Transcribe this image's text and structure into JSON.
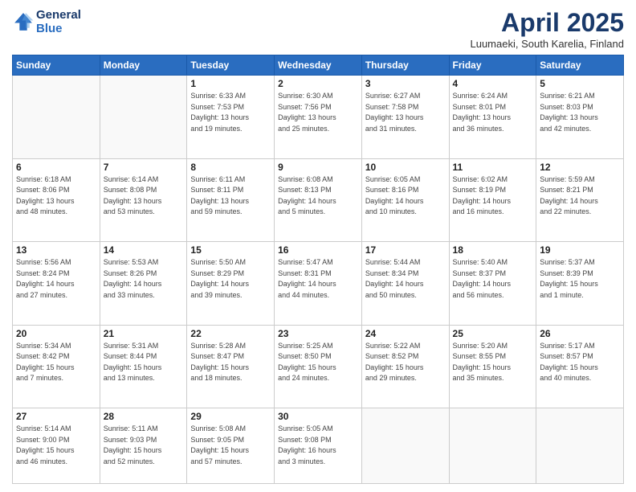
{
  "header": {
    "logo_line1": "General",
    "logo_line2": "Blue",
    "month": "April 2025",
    "location": "Luumaeki, South Karelia, Finland"
  },
  "weekdays": [
    "Sunday",
    "Monday",
    "Tuesday",
    "Wednesday",
    "Thursday",
    "Friday",
    "Saturday"
  ],
  "weeks": [
    [
      {
        "day": "",
        "info": ""
      },
      {
        "day": "",
        "info": ""
      },
      {
        "day": "1",
        "info": "Sunrise: 6:33 AM\nSunset: 7:53 PM\nDaylight: 13 hours\nand 19 minutes."
      },
      {
        "day": "2",
        "info": "Sunrise: 6:30 AM\nSunset: 7:56 PM\nDaylight: 13 hours\nand 25 minutes."
      },
      {
        "day": "3",
        "info": "Sunrise: 6:27 AM\nSunset: 7:58 PM\nDaylight: 13 hours\nand 31 minutes."
      },
      {
        "day": "4",
        "info": "Sunrise: 6:24 AM\nSunset: 8:01 PM\nDaylight: 13 hours\nand 36 minutes."
      },
      {
        "day": "5",
        "info": "Sunrise: 6:21 AM\nSunset: 8:03 PM\nDaylight: 13 hours\nand 42 minutes."
      }
    ],
    [
      {
        "day": "6",
        "info": "Sunrise: 6:18 AM\nSunset: 8:06 PM\nDaylight: 13 hours\nand 48 minutes."
      },
      {
        "day": "7",
        "info": "Sunrise: 6:14 AM\nSunset: 8:08 PM\nDaylight: 13 hours\nand 53 minutes."
      },
      {
        "day": "8",
        "info": "Sunrise: 6:11 AM\nSunset: 8:11 PM\nDaylight: 13 hours\nand 59 minutes."
      },
      {
        "day": "9",
        "info": "Sunrise: 6:08 AM\nSunset: 8:13 PM\nDaylight: 14 hours\nand 5 minutes."
      },
      {
        "day": "10",
        "info": "Sunrise: 6:05 AM\nSunset: 8:16 PM\nDaylight: 14 hours\nand 10 minutes."
      },
      {
        "day": "11",
        "info": "Sunrise: 6:02 AM\nSunset: 8:19 PM\nDaylight: 14 hours\nand 16 minutes."
      },
      {
        "day": "12",
        "info": "Sunrise: 5:59 AM\nSunset: 8:21 PM\nDaylight: 14 hours\nand 22 minutes."
      }
    ],
    [
      {
        "day": "13",
        "info": "Sunrise: 5:56 AM\nSunset: 8:24 PM\nDaylight: 14 hours\nand 27 minutes."
      },
      {
        "day": "14",
        "info": "Sunrise: 5:53 AM\nSunset: 8:26 PM\nDaylight: 14 hours\nand 33 minutes."
      },
      {
        "day": "15",
        "info": "Sunrise: 5:50 AM\nSunset: 8:29 PM\nDaylight: 14 hours\nand 39 minutes."
      },
      {
        "day": "16",
        "info": "Sunrise: 5:47 AM\nSunset: 8:31 PM\nDaylight: 14 hours\nand 44 minutes."
      },
      {
        "day": "17",
        "info": "Sunrise: 5:44 AM\nSunset: 8:34 PM\nDaylight: 14 hours\nand 50 minutes."
      },
      {
        "day": "18",
        "info": "Sunrise: 5:40 AM\nSunset: 8:37 PM\nDaylight: 14 hours\nand 56 minutes."
      },
      {
        "day": "19",
        "info": "Sunrise: 5:37 AM\nSunset: 8:39 PM\nDaylight: 15 hours\nand 1 minute."
      }
    ],
    [
      {
        "day": "20",
        "info": "Sunrise: 5:34 AM\nSunset: 8:42 PM\nDaylight: 15 hours\nand 7 minutes."
      },
      {
        "day": "21",
        "info": "Sunrise: 5:31 AM\nSunset: 8:44 PM\nDaylight: 15 hours\nand 13 minutes."
      },
      {
        "day": "22",
        "info": "Sunrise: 5:28 AM\nSunset: 8:47 PM\nDaylight: 15 hours\nand 18 minutes."
      },
      {
        "day": "23",
        "info": "Sunrise: 5:25 AM\nSunset: 8:50 PM\nDaylight: 15 hours\nand 24 minutes."
      },
      {
        "day": "24",
        "info": "Sunrise: 5:22 AM\nSunset: 8:52 PM\nDaylight: 15 hours\nand 29 minutes."
      },
      {
        "day": "25",
        "info": "Sunrise: 5:20 AM\nSunset: 8:55 PM\nDaylight: 15 hours\nand 35 minutes."
      },
      {
        "day": "26",
        "info": "Sunrise: 5:17 AM\nSunset: 8:57 PM\nDaylight: 15 hours\nand 40 minutes."
      }
    ],
    [
      {
        "day": "27",
        "info": "Sunrise: 5:14 AM\nSunset: 9:00 PM\nDaylight: 15 hours\nand 46 minutes."
      },
      {
        "day": "28",
        "info": "Sunrise: 5:11 AM\nSunset: 9:03 PM\nDaylight: 15 hours\nand 52 minutes."
      },
      {
        "day": "29",
        "info": "Sunrise: 5:08 AM\nSunset: 9:05 PM\nDaylight: 15 hours\nand 57 minutes."
      },
      {
        "day": "30",
        "info": "Sunrise: 5:05 AM\nSunset: 9:08 PM\nDaylight: 16 hours\nand 3 minutes."
      },
      {
        "day": "",
        "info": ""
      },
      {
        "day": "",
        "info": ""
      },
      {
        "day": "",
        "info": ""
      }
    ]
  ]
}
